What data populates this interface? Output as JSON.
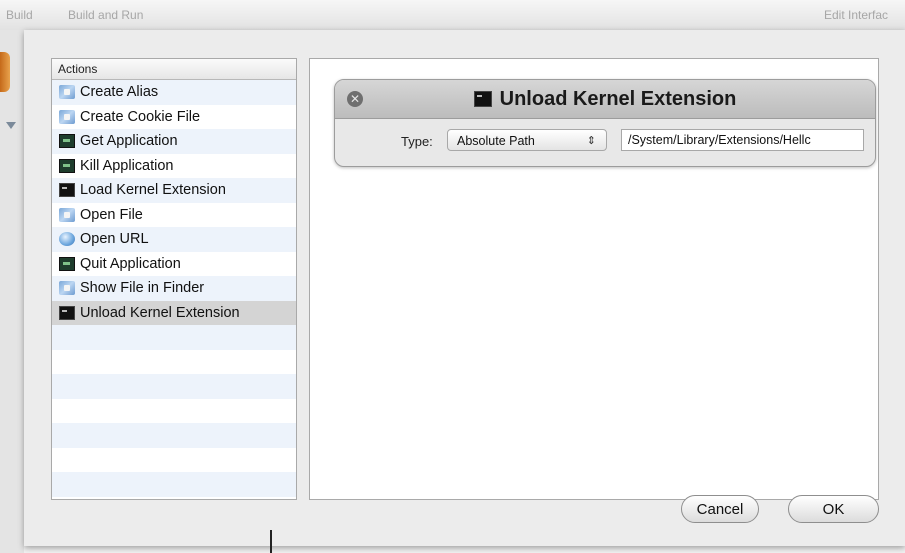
{
  "toolbar": {
    "build": "Build",
    "build_and_run": "Build and Run",
    "edit_interface": "Edit Interfac"
  },
  "actions": {
    "header": "Actions",
    "items": [
      {
        "label": "Create Alias",
        "icon": "finder-icon"
      },
      {
        "label": "Create Cookie File",
        "icon": "finder-icon"
      },
      {
        "label": "Get Application",
        "icon": "application-icon"
      },
      {
        "label": "Kill Application",
        "icon": "application-icon"
      },
      {
        "label": "Load Kernel Extension",
        "icon": "terminal-icon"
      },
      {
        "label": "Open File",
        "icon": "finder-icon"
      },
      {
        "label": "Open URL",
        "icon": "url-icon"
      },
      {
        "label": "Quit Application",
        "icon": "application-icon"
      },
      {
        "label": "Show File in Finder",
        "icon": "finder-icon"
      },
      {
        "label": "Unload Kernel Extension",
        "icon": "terminal-icon"
      }
    ],
    "selected": "Unload Kernel Extension"
  },
  "editor": {
    "title": "Unload Kernel Extension",
    "type_label": "Type:",
    "type_value": "Absolute Path",
    "path_value": "/System/Library/Extensions/Hellc"
  },
  "buttons": {
    "cancel": "Cancel",
    "ok": "OK"
  }
}
